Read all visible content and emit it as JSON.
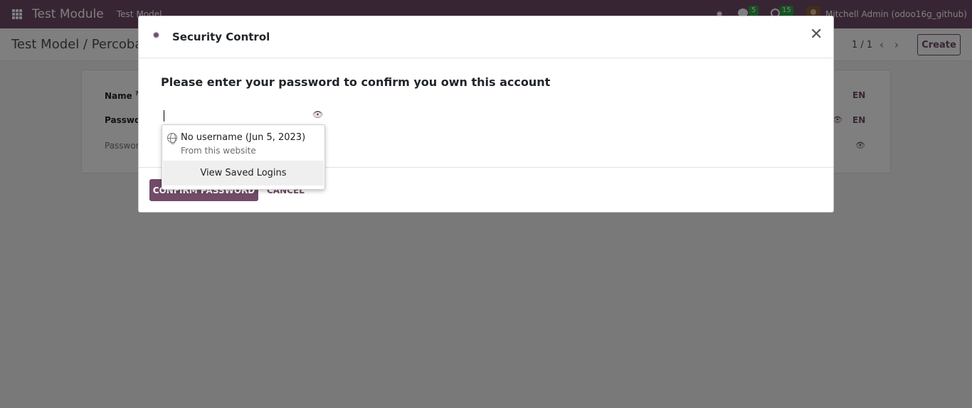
{
  "navbar": {
    "app_name": "Test Module",
    "menu_item": "Test Model",
    "chat_badge": "5",
    "activity_badge": "15",
    "user": "Mitchell Admin (odoo16g_github)",
    "color": "#714B67"
  },
  "control_panel": {
    "breadcrumb": "Test Model / Percobaan",
    "pager": "1 / 1",
    "create_label": "Create"
  },
  "form": {
    "name_label": "Name",
    "name_help": "?",
    "password_label": "Password",
    "password2_label": "Password",
    "lang1": "EN",
    "lang2": "EN"
  },
  "dialog": {
    "title": "Security Control",
    "prompt": "Please enter your password to confirm you own this account",
    "password_value": "",
    "confirm_label": "CONFIRM PASSWORD",
    "cancel_label": "CANCEL"
  },
  "autofill": {
    "entry_title": "No username (Jun 5, 2023)",
    "entry_subtitle": "From this website",
    "view_saved_label": "View Saved Logins"
  },
  "icons": {
    "apps": "apps-grid-icon",
    "debug": "bug-icon",
    "chat": "chat-icon",
    "activity": "clock-icon",
    "close": "close-icon",
    "eye": "eye-icon",
    "globe": "globe-icon"
  }
}
